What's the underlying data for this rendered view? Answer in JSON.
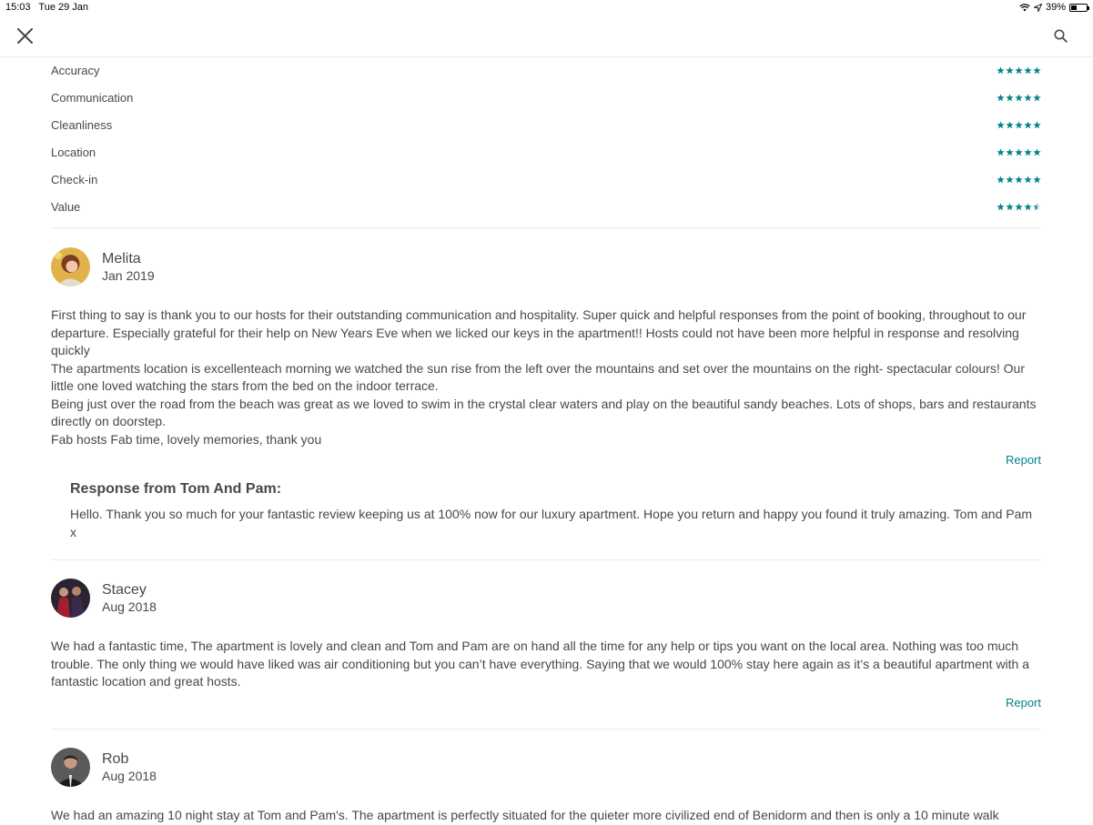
{
  "status_bar": {
    "time": "15:03",
    "date": "Tue 29 Jan",
    "battery": "39%",
    "battery_level": 0.39
  },
  "nav": {
    "close_icon": "close-icon",
    "search_icon": "search-icon"
  },
  "colors": {
    "star": "#008489",
    "report": "#008489",
    "text": "#484848"
  },
  "ratings": [
    {
      "label": "Accuracy",
      "stars": 5
    },
    {
      "label": "Communication",
      "stars": 5
    },
    {
      "label": "Cleanliness",
      "stars": 5
    },
    {
      "label": "Location",
      "stars": 5
    },
    {
      "label": "Check-in",
      "stars": 5
    },
    {
      "label": "Value",
      "stars": 4.5
    }
  ],
  "reviews": [
    {
      "name": "Melita",
      "date": "Jan 2019",
      "paragraphs": [
        "First thing to say is thank you to our hosts for their outstanding communication and hospitality. Super quick and helpful responses from the point of booking, throughout to our departure. Especially grateful for their help on New Years Eve when we licked our keys in the apartment!! Hosts could not have been more helpful in response and resolving quickly",
        "The apartments location is excellenteach morning we watched the sun rise from the left over the mountains and set over the mountains on the right- spectacular colours! Our little one loved watching the stars from the bed on the indoor terrace.",
        "Being just over the road from the beach was great as we loved to swim in the crystal clear waters and play on the beautiful sandy beaches. Lots of shops, bars and restaurants directly on doorstep.",
        "Fab hosts Fab time, lovely memories, thank you"
      ],
      "report": "Report",
      "response": {
        "title": "Response from Tom And Pam:",
        "text": "Hello. Thank you so much for your fantastic review keeping us at 100% now for our luxury apartment. Hope you return and happy you found it truly amazing. Tom and Pam x"
      }
    },
    {
      "name": "Stacey",
      "date": "Aug 2018",
      "paragraphs": [
        "We had a fantastic time, The apartment is lovely and clean and Tom and Pam are on hand all the time for any help or tips you want on the local area. Nothing was too much trouble. The only thing we would have liked was air conditioning but you can’t have everything. Saying that we would 100% stay here again as it’s a beautiful apartment with a fantastic location and great hosts."
      ],
      "report": "Report"
    },
    {
      "name": "Rob",
      "date": "Aug 2018",
      "paragraphs": [
        "We had an amazing 10 night stay at Tom and Pam's.  The apartment is perfectly situated for the quieter more civilized end of Benidorm and then is only a 10 minute walk"
      ]
    }
  ]
}
